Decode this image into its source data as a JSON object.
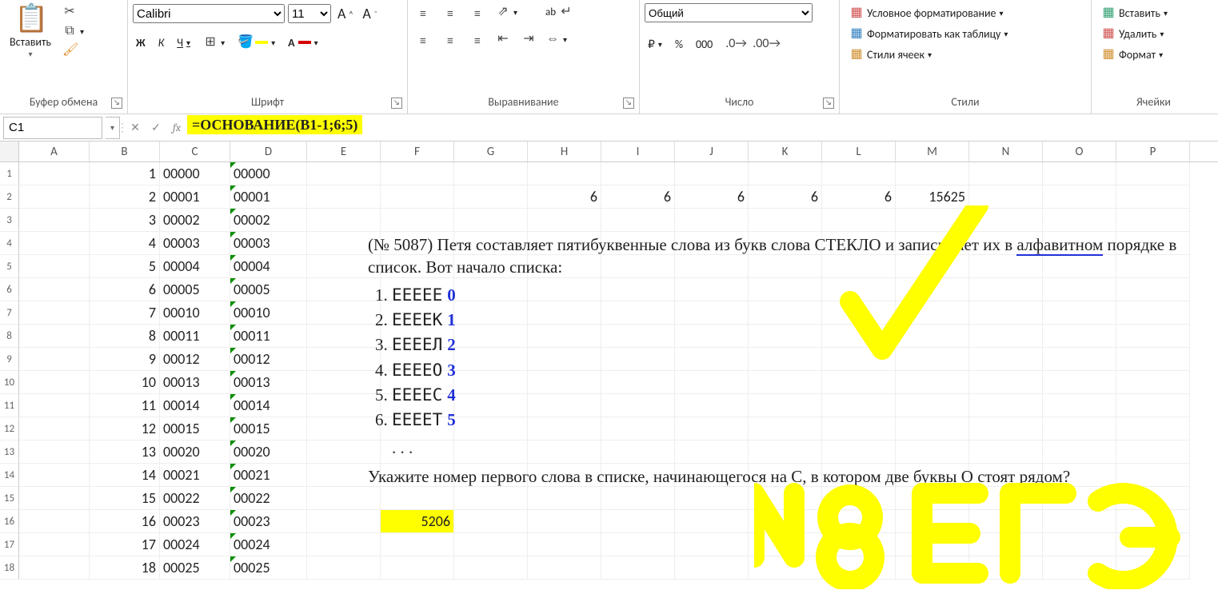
{
  "ribbon": {
    "clipboard": {
      "paste": "Вставить",
      "label": "Буфер обмена"
    },
    "font": {
      "name_value": "Calibri",
      "size_value": "11",
      "bold": "Ж",
      "italic": "К",
      "underline": "Ч",
      "label": "Шрифт"
    },
    "alignment": {
      "label": "Выравнивание",
      "wrap_symbol": "ab"
    },
    "number": {
      "format_value": "Общий",
      "label": "Число",
      "percent": "%",
      "zeros": "000",
      "cur": "₽"
    },
    "styles": {
      "cond": "Условное форматирование",
      "tbl": "Форматировать как таблицу",
      "cell": "Стили ячеек",
      "label": "Стили"
    },
    "cells": {
      "insert": "Вставить",
      "delete": "Удалить",
      "format": "Формат",
      "label": "Ячейки"
    }
  },
  "fbar": {
    "cell_ref": "C1",
    "fx": "fx",
    "formula": "=ОСНОВАНИЕ(B1-1;6;5)"
  },
  "cols": [
    "A",
    "B",
    "C",
    "D",
    "E",
    "F",
    "G",
    "H",
    "I",
    "J",
    "K",
    "L",
    "M",
    "N",
    "O",
    "P"
  ],
  "grid": {
    "colB": [
      1,
      2,
      3,
      4,
      5,
      6,
      7,
      8,
      9,
      10,
      11,
      12,
      13,
      14,
      15,
      16,
      17,
      18
    ],
    "colC": [
      "00000",
      "00001",
      "00002",
      "00003",
      "00004",
      "00005",
      "00010",
      "00011",
      "00012",
      "00013",
      "00014",
      "00015",
      "00020",
      "00021",
      "00022",
      "00023",
      "00024",
      "00025"
    ],
    "colD": [
      "00000",
      "00001",
      "00002",
      "00003",
      "00004",
      "00005",
      "00010",
      "00011",
      "00012",
      "00013",
      "00014",
      "00015",
      "00020",
      "00021",
      "00022",
      "00023",
      "00024",
      "00025"
    ],
    "row2_tail": {
      "H": 6,
      "I": 6,
      "J": 6,
      "K": 6,
      "L": 6,
      "M": 15625
    },
    "f16": "5206"
  },
  "problem": {
    "lead": "(№ 5087) Петя составляет пятибуквенные слова из букв слова СТЕКЛО и записывает их в ",
    "underlined": "алфавитном",
    "after": " порядке в список. Вот начало списка:",
    "list": [
      "ЕЕЕЕЕ",
      "ЕЕЕЕК",
      "ЕЕЕЕЛ",
      "ЕЕЕЕО",
      "ЕЕЕЕС",
      "ЕЕЕЕТ"
    ],
    "pen_digits": [
      "0",
      "1",
      "2",
      "3",
      "4",
      "5"
    ],
    "dots": ". . .",
    "question": "Укажите номер первого слова в списке, начинающегося на С, в котором две буквы О стоят рядом?"
  }
}
